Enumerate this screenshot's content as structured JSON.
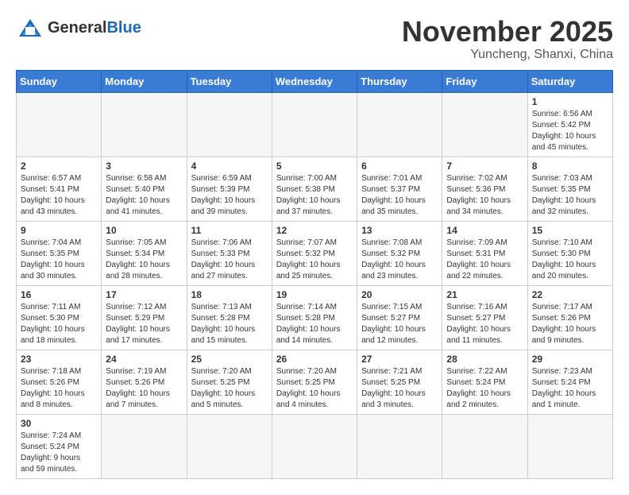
{
  "header": {
    "logo_text_normal": "General",
    "logo_text_blue": "Blue",
    "month_title": "November 2025",
    "subtitle": "Yuncheng, Shanxi, China"
  },
  "weekdays": [
    "Sunday",
    "Monday",
    "Tuesday",
    "Wednesday",
    "Thursday",
    "Friday",
    "Saturday"
  ],
  "weeks": [
    [
      {
        "day": "",
        "info": ""
      },
      {
        "day": "",
        "info": ""
      },
      {
        "day": "",
        "info": ""
      },
      {
        "day": "",
        "info": ""
      },
      {
        "day": "",
        "info": ""
      },
      {
        "day": "",
        "info": ""
      },
      {
        "day": "1",
        "info": "Sunrise: 6:56 AM\nSunset: 5:42 PM\nDaylight: 10 hours\nand 45 minutes."
      }
    ],
    [
      {
        "day": "2",
        "info": "Sunrise: 6:57 AM\nSunset: 5:41 PM\nDaylight: 10 hours\nand 43 minutes."
      },
      {
        "day": "3",
        "info": "Sunrise: 6:58 AM\nSunset: 5:40 PM\nDaylight: 10 hours\nand 41 minutes."
      },
      {
        "day": "4",
        "info": "Sunrise: 6:59 AM\nSunset: 5:39 PM\nDaylight: 10 hours\nand 39 minutes."
      },
      {
        "day": "5",
        "info": "Sunrise: 7:00 AM\nSunset: 5:38 PM\nDaylight: 10 hours\nand 37 minutes."
      },
      {
        "day": "6",
        "info": "Sunrise: 7:01 AM\nSunset: 5:37 PM\nDaylight: 10 hours\nand 35 minutes."
      },
      {
        "day": "7",
        "info": "Sunrise: 7:02 AM\nSunset: 5:36 PM\nDaylight: 10 hours\nand 34 minutes."
      },
      {
        "day": "8",
        "info": "Sunrise: 7:03 AM\nSunset: 5:35 PM\nDaylight: 10 hours\nand 32 minutes."
      }
    ],
    [
      {
        "day": "9",
        "info": "Sunrise: 7:04 AM\nSunset: 5:35 PM\nDaylight: 10 hours\nand 30 minutes."
      },
      {
        "day": "10",
        "info": "Sunrise: 7:05 AM\nSunset: 5:34 PM\nDaylight: 10 hours\nand 28 minutes."
      },
      {
        "day": "11",
        "info": "Sunrise: 7:06 AM\nSunset: 5:33 PM\nDaylight: 10 hours\nand 27 minutes."
      },
      {
        "day": "12",
        "info": "Sunrise: 7:07 AM\nSunset: 5:32 PM\nDaylight: 10 hours\nand 25 minutes."
      },
      {
        "day": "13",
        "info": "Sunrise: 7:08 AM\nSunset: 5:32 PM\nDaylight: 10 hours\nand 23 minutes."
      },
      {
        "day": "14",
        "info": "Sunrise: 7:09 AM\nSunset: 5:31 PM\nDaylight: 10 hours\nand 22 minutes."
      },
      {
        "day": "15",
        "info": "Sunrise: 7:10 AM\nSunset: 5:30 PM\nDaylight: 10 hours\nand 20 minutes."
      }
    ],
    [
      {
        "day": "16",
        "info": "Sunrise: 7:11 AM\nSunset: 5:30 PM\nDaylight: 10 hours\nand 18 minutes."
      },
      {
        "day": "17",
        "info": "Sunrise: 7:12 AM\nSunset: 5:29 PM\nDaylight: 10 hours\nand 17 minutes."
      },
      {
        "day": "18",
        "info": "Sunrise: 7:13 AM\nSunset: 5:28 PM\nDaylight: 10 hours\nand 15 minutes."
      },
      {
        "day": "19",
        "info": "Sunrise: 7:14 AM\nSunset: 5:28 PM\nDaylight: 10 hours\nand 14 minutes."
      },
      {
        "day": "20",
        "info": "Sunrise: 7:15 AM\nSunset: 5:27 PM\nDaylight: 10 hours\nand 12 minutes."
      },
      {
        "day": "21",
        "info": "Sunrise: 7:16 AM\nSunset: 5:27 PM\nDaylight: 10 hours\nand 11 minutes."
      },
      {
        "day": "22",
        "info": "Sunrise: 7:17 AM\nSunset: 5:26 PM\nDaylight: 10 hours\nand 9 minutes."
      }
    ],
    [
      {
        "day": "23",
        "info": "Sunrise: 7:18 AM\nSunset: 5:26 PM\nDaylight: 10 hours\nand 8 minutes."
      },
      {
        "day": "24",
        "info": "Sunrise: 7:19 AM\nSunset: 5:26 PM\nDaylight: 10 hours\nand 7 minutes."
      },
      {
        "day": "25",
        "info": "Sunrise: 7:20 AM\nSunset: 5:25 PM\nDaylight: 10 hours\nand 5 minutes."
      },
      {
        "day": "26",
        "info": "Sunrise: 7:20 AM\nSunset: 5:25 PM\nDaylight: 10 hours\nand 4 minutes."
      },
      {
        "day": "27",
        "info": "Sunrise: 7:21 AM\nSunset: 5:25 PM\nDaylight: 10 hours\nand 3 minutes."
      },
      {
        "day": "28",
        "info": "Sunrise: 7:22 AM\nSunset: 5:24 PM\nDaylight: 10 hours\nand 2 minutes."
      },
      {
        "day": "29",
        "info": "Sunrise: 7:23 AM\nSunset: 5:24 PM\nDaylight: 10 hours\nand 1 minute."
      }
    ],
    [
      {
        "day": "30",
        "info": "Sunrise: 7:24 AM\nSunset: 5:24 PM\nDaylight: 9 hours\nand 59 minutes."
      },
      {
        "day": "",
        "info": ""
      },
      {
        "day": "",
        "info": ""
      },
      {
        "day": "",
        "info": ""
      },
      {
        "day": "",
        "info": ""
      },
      {
        "day": "",
        "info": ""
      },
      {
        "day": "",
        "info": ""
      }
    ]
  ]
}
